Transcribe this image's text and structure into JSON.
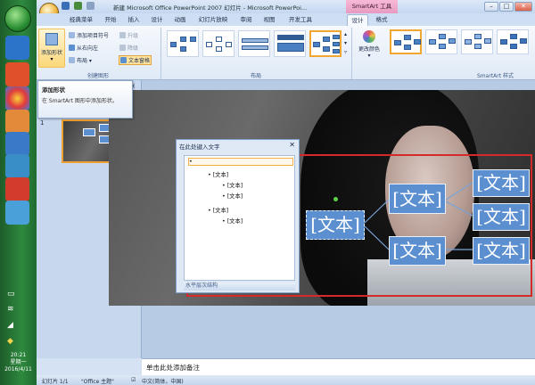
{
  "window": {
    "title": "新建 Microsoft Office PowerPoint 2007 幻灯片 - Microsoft PowerPoi...",
    "context_tab": "SmartArt 工具"
  },
  "tabs": [
    "经典菜单",
    "开始",
    "插入",
    "设计",
    "动画",
    "幻灯片放映",
    "审阅",
    "视图",
    "开发工具",
    "设计",
    "格式"
  ],
  "active_tab_index": 9,
  "ribbon": {
    "create_graphic": {
      "label": "创建图形",
      "add_shape": "添加形状",
      "add_bullet": "添加项目符号",
      "right_to_left": "从右向左",
      "layout": "布局",
      "promote": "升级",
      "demote": "降级",
      "text_pane": "文本窗格"
    },
    "layouts": {
      "label": "布局"
    },
    "styles": {
      "label": "SmartArt 样式",
      "change_colors": "更改颜色"
    }
  },
  "tooltip": {
    "title": "添加形状",
    "text": "在 SmartArt 图形中添加形状。"
  },
  "slides_pane": {
    "slide_number": "1"
  },
  "text_pane": {
    "title": "在此处键入文字",
    "bullets": [
      {
        "level": 1,
        "text": ""
      },
      {
        "level": 2,
        "text": "[文本]"
      },
      {
        "level": 3,
        "text": "[文本]"
      },
      {
        "level": 3,
        "text": "[文本]"
      },
      {
        "level": 2,
        "text": "[文本]"
      },
      {
        "level": 3,
        "text": "[文本]"
      }
    ],
    "footer": "水平层次结构"
  },
  "smartart_nodes": [
    "[文本]",
    "[文本]",
    "[文本]",
    "[文本]",
    "[文本]",
    "[文本]",
    "[文本]"
  ],
  "notes": {
    "placeholder": "单击此处添加备注"
  },
  "status_bar": {
    "slide": "幻灯片 1/1",
    "theme": "\"Office 主题\"",
    "language": "中文(简体，中国)"
  },
  "system_tray": {
    "time": "20:21",
    "weekday": "星期一",
    "date": "2016/4/11"
  }
}
